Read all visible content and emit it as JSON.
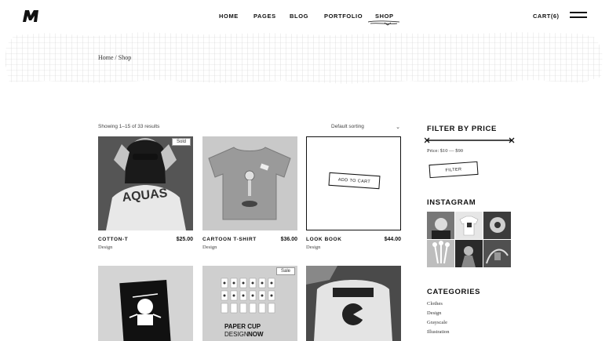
{
  "header": {
    "nav": [
      "HOME",
      "PAGES",
      "BLOG",
      "PORTFOLIO",
      "SHOP"
    ],
    "cart": "CART(6)",
    "logo": "M-logo",
    "menu_icon": "hamburger-icon"
  },
  "breadcrumb": "Home / Shop",
  "shop": {
    "showing": "Showing 1–15 of 33 results",
    "sorting": "Default sorting",
    "products": [
      {
        "name": "COTTON-T",
        "price": "$25.00",
        "category": "Design",
        "badge": "Sold"
      },
      {
        "name": "CARTOON T-SHIRT",
        "price": "$36.00",
        "category": "Design"
      },
      {
        "name": "LOOK BOOK",
        "price": "$44.00",
        "category": "Design",
        "button": "ADD TO CART"
      },
      {
        "name": "",
        "price": "",
        "category": ""
      },
      {
        "name": "",
        "price": "",
        "category": "",
        "badge": "Sale"
      },
      {
        "name": "",
        "price": "",
        "category": ""
      }
    ],
    "cup_poster_line1": "PAPER CUP",
    "cup_poster_line2a": "DESIGN",
    "cup_poster_line2b": "NOW",
    "shirt_text": "AQUAS"
  },
  "sidebar": {
    "filter_title": "FILTER BY PRICE",
    "price_label": "Price: $10 — $90",
    "filter_button": "FILTER",
    "instagram_title": "INSTAGRAM",
    "categories_title": "CATEGORIES",
    "categories": [
      "Clothes",
      "Design",
      "Grayscale",
      "Illustration"
    ]
  }
}
